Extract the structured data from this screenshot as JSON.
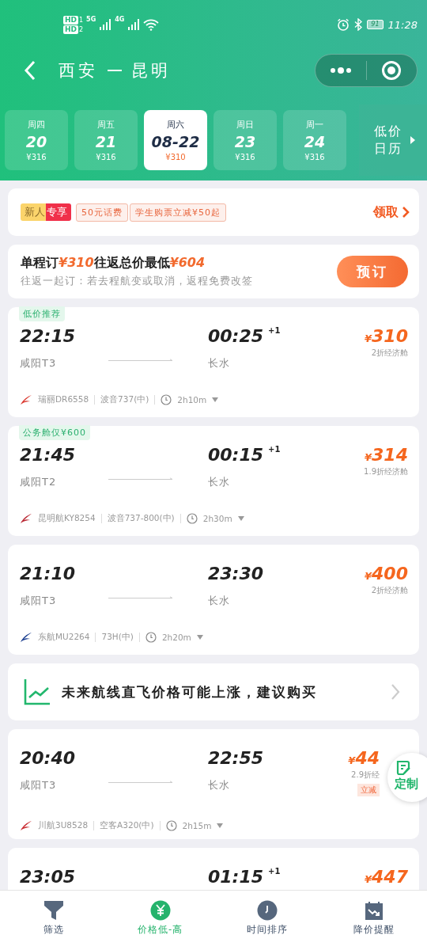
{
  "status_bar": {
    "sims": [
      {
        "label": "HD",
        "slot": "1"
      },
      {
        "label": "HD",
        "slot": "2"
      }
    ],
    "networks": [
      "5G",
      "4G"
    ],
    "battery": "91",
    "time": "11:28"
  },
  "header": {
    "from": "西安",
    "to": "昆明"
  },
  "dates": [
    {
      "weekday": "周四",
      "date": "20",
      "price": "¥316",
      "selected": false
    },
    {
      "weekday": "周五",
      "date": "21",
      "price": "¥316",
      "selected": false
    },
    {
      "weekday": "周六",
      "date": "08-22",
      "price": "¥310",
      "selected": true
    },
    {
      "weekday": "周日",
      "date": "23",
      "price": "¥316",
      "selected": false
    },
    {
      "weekday": "周一",
      "date": "24",
      "price": "¥316",
      "selected": false
    }
  ],
  "calendar_button": "低价日历",
  "promo": {
    "badge": [
      "新人",
      "专享"
    ],
    "coupons": [
      "50元话费",
      "学生购票立减¥50起"
    ],
    "action": "领取"
  },
  "round_trip": {
    "headline": [
      {
        "kind": "text",
        "text": "单程订"
      },
      {
        "kind": "price",
        "text": "¥310"
      },
      {
        "kind": "text",
        "text": "往返总价最低"
      },
      {
        "kind": "price",
        "text": "¥604"
      }
    ],
    "note": "往返一起订：若去程航变或取消，返程免费改签",
    "button": "预订"
  },
  "flights": [
    {
      "tag": "低价推荐",
      "dep_time": "22:15",
      "dep_airport": "咸阳T3",
      "arr_time": "00:25",
      "next_day": "+1",
      "arr_airport": "长水",
      "currency": "¥",
      "price": "310",
      "discount": "2折经济舱",
      "airline": "瑞丽DR6558",
      "aircraft": "波音737(中)",
      "duration": "2h10m",
      "color": "#d9342b"
    },
    {
      "tag": "公务舱仅¥600",
      "dep_time": "21:45",
      "dep_airport": "咸阳T2",
      "arr_time": "00:15",
      "next_day": "+1",
      "arr_airport": "长水",
      "currency": "¥",
      "price": "314",
      "discount": "1.9折经济舱",
      "airline": "昆明航KY8254",
      "aircraft": "波音737-800(中)",
      "duration": "2h30m",
      "color": "#b8232f"
    },
    {
      "dep_time": "21:10",
      "dep_airport": "咸阳T3",
      "arr_time": "23:30",
      "arr_airport": "长水",
      "currency": "¥",
      "price": "400",
      "discount": "2折经济舱",
      "airline": "东航MU2264",
      "aircraft": "73H(中)",
      "duration": "2h20m",
      "color": "#1a3d8f"
    },
    {
      "kind": "trend",
      "text": "未来航线直飞价格可能上涨，建议购买"
    },
    {
      "dep_time": "20:40",
      "dep_airport": "咸阳T3",
      "arr_time": "22:55",
      "arr_airport": "长水",
      "currency": "¥",
      "price": "44",
      "discount": "2.9折经",
      "badge": "立减",
      "airline": "川航3U8528",
      "aircraft": "空客A320(中)",
      "duration": "2h15m",
      "color": "#c8282e",
      "overlay": {
        "label": "定制"
      }
    },
    {
      "dep_time": "23:05",
      "arr_time": "01:15",
      "next_day": "+1",
      "currency": "¥",
      "price": "447"
    }
  ],
  "nav": [
    {
      "label": "筛选",
      "selected": false
    },
    {
      "label": "价格低-高",
      "selected": true
    },
    {
      "label": "时间排序",
      "selected": false
    },
    {
      "label": "降价提醒",
      "selected": false
    }
  ]
}
